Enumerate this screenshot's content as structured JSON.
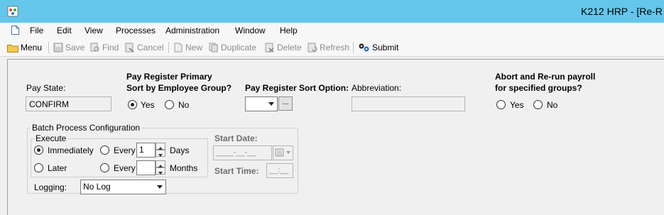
{
  "window": {
    "title": "K212 HRP - [Re-R"
  },
  "menubar": {
    "items": [
      "File",
      "Edit",
      "View",
      "Processes",
      "Administration",
      "Window",
      "Help"
    ]
  },
  "toolbar": {
    "menu": "Menu",
    "save": "Save",
    "find": "Find",
    "cancel": "Cancel",
    "new": "New",
    "duplicate": "Duplicate",
    "delete": "Delete",
    "refresh": "Refresh",
    "submit": "Submit"
  },
  "form": {
    "pay_state_label": "Pay State:",
    "pay_state_value": "CONFIRM",
    "sort_group_label_line1": "Pay Register Primary",
    "sort_group_label_line2": "Sort by Employee Group?",
    "yes": "Yes",
    "no": "No",
    "sort_option_label": "Pay Register Sort Option:",
    "sort_option_value": "",
    "more_button": "...",
    "abbreviation_label": "Abbreviation:",
    "abbreviation_value": "",
    "abort_label_line1": "Abort and Re-run payroll",
    "abort_label_line2": "for specified groups?"
  },
  "batch": {
    "legend": "Batch Process Configuration",
    "execute_legend": "Execute",
    "immediately": "Immediately",
    "later": "Later",
    "every": "Every",
    "days_value": "1",
    "days_label": "Days",
    "months_value": "",
    "months_label": "Months",
    "start_date_label": "Start Date:",
    "start_date_value": "____-__-__",
    "start_time_label": "Start Time:",
    "start_time_value": "__:__",
    "logging_label": "Logging:",
    "logging_value": "No Log"
  }
}
